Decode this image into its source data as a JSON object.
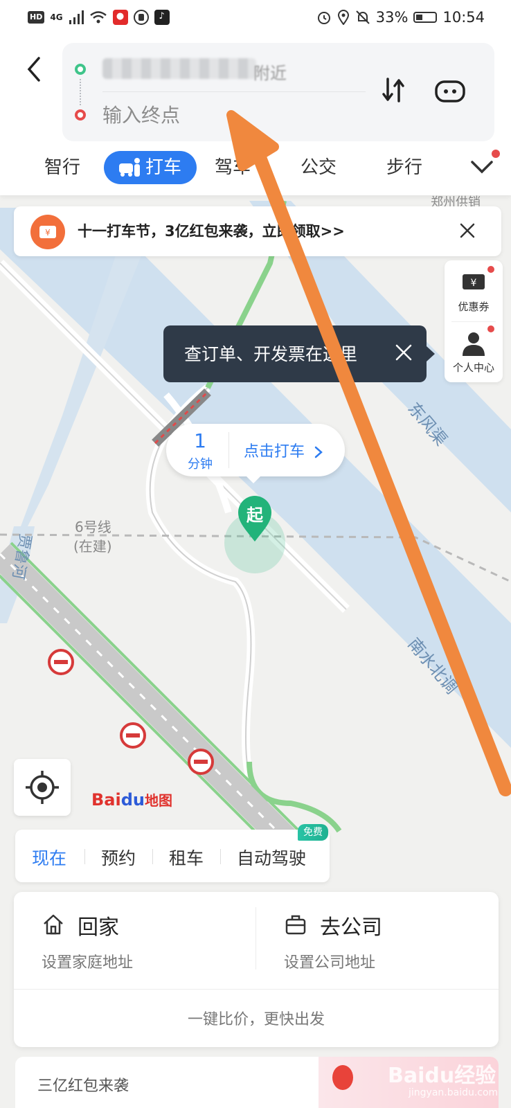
{
  "status_bar": {
    "hd": "HD",
    "network": "4G",
    "battery": "33%",
    "time": "10:54"
  },
  "route": {
    "start_value_visible": "附近",
    "end_placeholder": "输入终点"
  },
  "tabs": [
    {
      "label": "智行"
    },
    {
      "label": "打车"
    },
    {
      "label": "驾车"
    },
    {
      "label": "公交"
    },
    {
      "label": "步行"
    }
  ],
  "banner": {
    "text": "十一打车节，3亿红包来袭，立即领取>>"
  },
  "side_panel": {
    "coupon_label": "优惠券",
    "profile_label": "个人中心"
  },
  "tooltip": {
    "text": "查订单、开发票在这里"
  },
  "taxi_bubble": {
    "eta_value": "1",
    "eta_unit": "分钟",
    "cta": "点击打车"
  },
  "start_pin": {
    "label": "起"
  },
  "map_labels": {
    "metro_line": "6号线",
    "metro_status": "(在建)",
    "road_left": "贾鲁河",
    "road_right_top": "东风渠",
    "road_right_bottom": "南水北调",
    "top_right": "郑州供销"
  },
  "logo": {
    "bai": "Bai",
    "du": "du",
    "map": "地图"
  },
  "mode_tabs": [
    {
      "label": "现在"
    },
    {
      "label": "预约"
    },
    {
      "label": "租车"
    },
    {
      "label": "自动驾驶"
    }
  ],
  "mode_badge": "免费",
  "destinations": {
    "home_title": "回家",
    "home_sub": "设置家庭地址",
    "work_title": "去公司",
    "work_sub": "设置公司地址",
    "compare": "一键比价，更快出发"
  },
  "bottom_promo": {
    "text": "三亿红包来袭"
  },
  "watermark": {
    "main": "Baidu经验",
    "sub": "jingyan.baidu.com"
  },
  "colors": {
    "accent": "#2d7cf1",
    "start_green": "#3fc48a",
    "end_red": "#e64b4b",
    "annotation_arrow": "#f0883e",
    "river": "#c9dcee"
  }
}
